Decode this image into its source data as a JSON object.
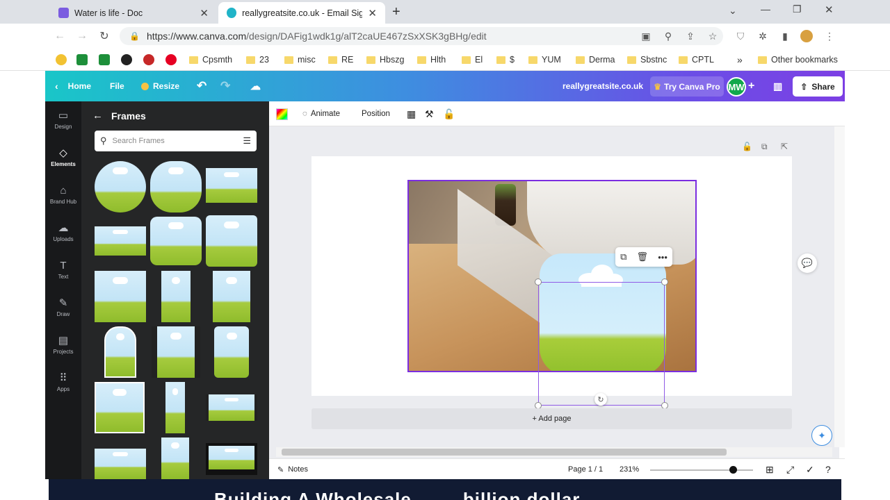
{
  "browser": {
    "tabs": [
      {
        "title": "Water is life - Doc",
        "favicon_color": "#7b5ce0"
      },
      {
        "title": "reallygreatsite.co.uk - Email Sign",
        "favicon_color": "#20b4c8"
      }
    ],
    "new_tab_label": "+",
    "url_host": "https://www.canva.com",
    "url_path": "/design/DAFig1wdk1g/alT2caUE467zSxXSK3gBHg/edit",
    "bookmarks": [
      "Cpsmth",
      "23",
      "misc",
      "RE",
      "Hbszg",
      "Hlth",
      "El",
      "$",
      "YUM",
      "Derma",
      "Sbstnc",
      "CPTL"
    ],
    "overflow_label": "»",
    "other_bookmarks": "Other bookmarks"
  },
  "canva": {
    "home_label": "Home",
    "file_label": "File",
    "resize_label": "Resize",
    "site_title": "reallygreatsite.co.uk",
    "try_pro_label": "Try Canva Pro",
    "avatar_initials": "MW",
    "share_label": "Share"
  },
  "rail": [
    {
      "label": "Design",
      "icon": "design-icon"
    },
    {
      "label": "Elements",
      "icon": "elements-icon"
    },
    {
      "label": "Brand Hub",
      "icon": "brand-hub-icon"
    },
    {
      "label": "Uploads",
      "icon": "uploads-icon"
    },
    {
      "label": "Text",
      "icon": "text-icon"
    },
    {
      "label": "Draw",
      "icon": "draw-icon"
    },
    {
      "label": "Projects",
      "icon": "projects-icon"
    },
    {
      "label": "Apps",
      "icon": "apps-icon"
    }
  ],
  "panel": {
    "title": "Frames",
    "search_placeholder": "Search Frames"
  },
  "context_bar": {
    "animate_label": "Animate",
    "position_label": "Position"
  },
  "editor": {
    "add_page_label": "+ Add page"
  },
  "footer": {
    "notes_label": "Notes",
    "page_indicator": "Page 1 / 1",
    "zoom": "231%"
  },
  "bottom_band_text": "Building A Wholesale ... ... billion dollar",
  "colors": {
    "brand_start": "#19c6c8",
    "brand_end": "#7c3fe4",
    "selection": "#7b2ee0"
  }
}
